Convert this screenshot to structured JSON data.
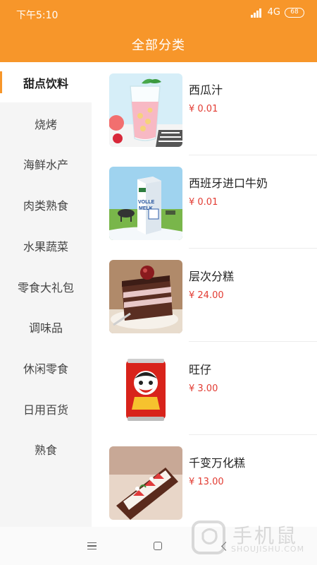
{
  "status_bar": {
    "time": "下午5:10",
    "network": "4G",
    "battery": "68"
  },
  "header": {
    "title": "全部分类"
  },
  "sidebar": {
    "items": [
      {
        "label": "甜点饮料",
        "active": true
      },
      {
        "label": "烧烤"
      },
      {
        "label": "海鲜水产"
      },
      {
        "label": "肉类熟食"
      },
      {
        "label": "水果蔬菜"
      },
      {
        "label": "零食大礼包"
      },
      {
        "label": "调味品"
      },
      {
        "label": "休闲零食"
      },
      {
        "label": "日用百货"
      },
      {
        "label": "熟食"
      }
    ]
  },
  "products": [
    {
      "name": "西瓜汁",
      "price": "¥ 0.01"
    },
    {
      "name": "西班牙进口牛奶",
      "price": "¥ 0.01",
      "box_text": "VOLLE MELK"
    },
    {
      "name": "层次分糕",
      "price": "¥ 24.00"
    },
    {
      "name": "旺仔",
      "price": "¥ 3.00"
    },
    {
      "name": "千变万化糕",
      "price": "¥ 13.00"
    }
  ],
  "watermark": {
    "text": "手机鼠",
    "sub": "SHOUJISHU.COM"
  },
  "colors": {
    "accent": "#f7962a",
    "price": "#e23b32"
  }
}
